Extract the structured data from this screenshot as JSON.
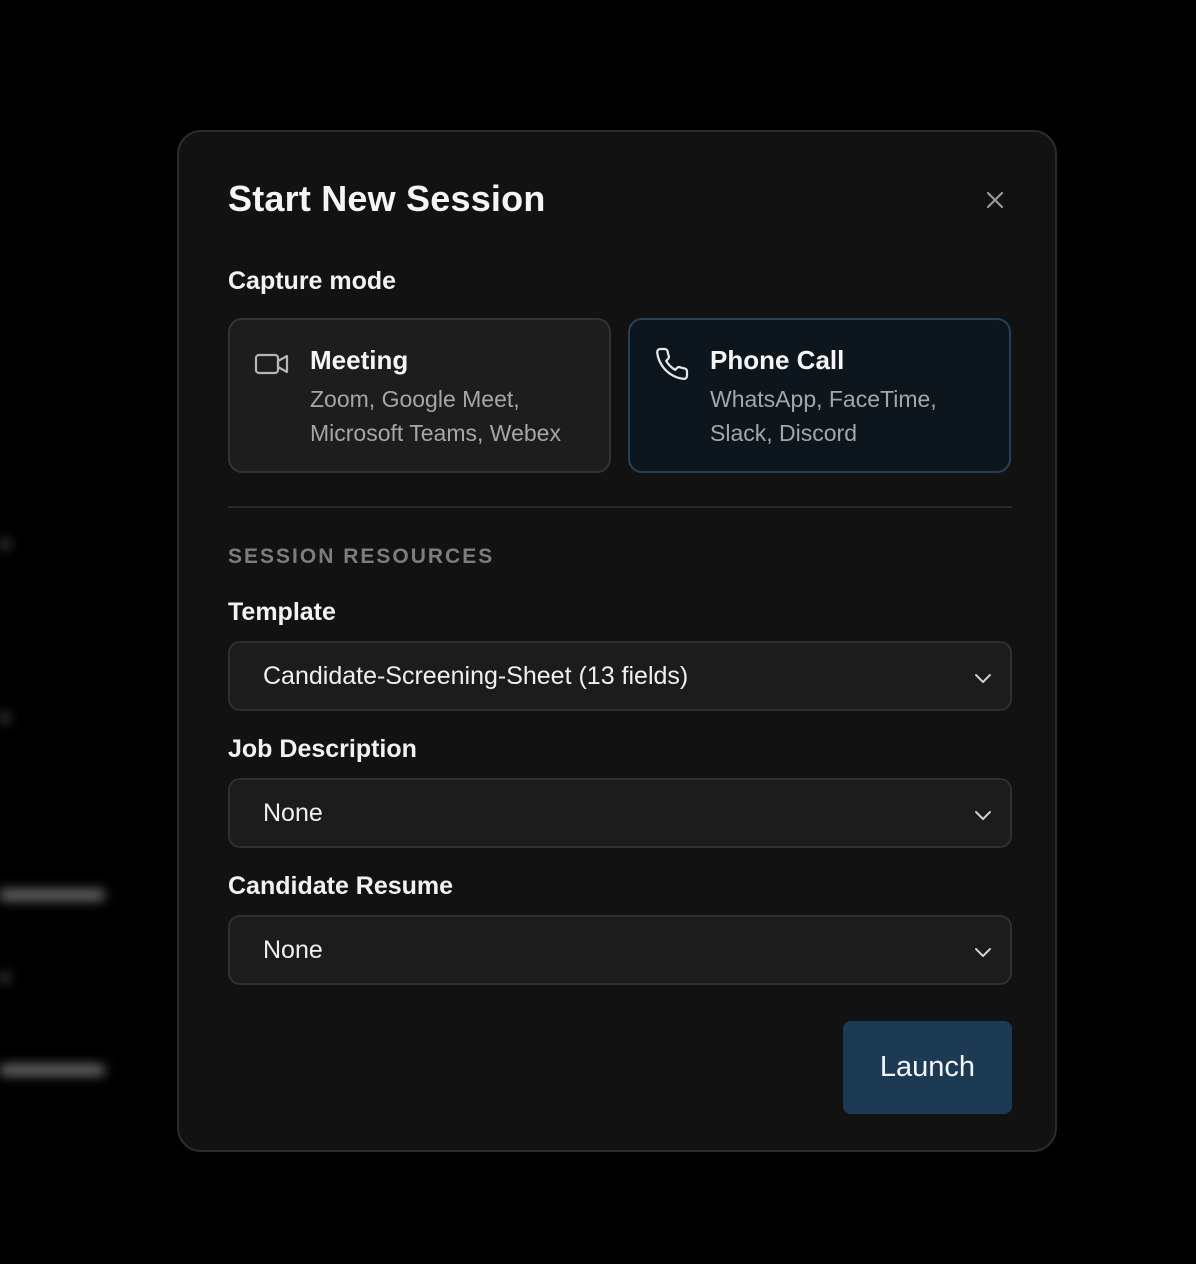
{
  "modal": {
    "title": "Start New Session",
    "close_icon": "close-icon"
  },
  "capture_mode": {
    "label": "Capture mode",
    "options": [
      {
        "title": "Meeting",
        "description": "Zoom, Google Meet, Microsoft Teams, Webex",
        "icon": "video-camera-icon",
        "selected": false
      },
      {
        "title": "Phone Call",
        "description": "WhatsApp, FaceTime, Slack, Discord",
        "icon": "phone-icon",
        "selected": true
      }
    ]
  },
  "resources": {
    "heading": "SESSION RESOURCES",
    "template": {
      "label": "Template",
      "value": "Candidate-Screening-Sheet (13 fields)"
    },
    "job_description": {
      "label": "Job Description",
      "value": "None"
    },
    "candidate_resume": {
      "label": "Candidate Resume",
      "value": "None"
    }
  },
  "actions": {
    "launch_label": "Launch"
  },
  "colors": {
    "modal_bg": "#121212",
    "selected_card_border": "#25415a",
    "launch_button": "#1d3a55"
  }
}
